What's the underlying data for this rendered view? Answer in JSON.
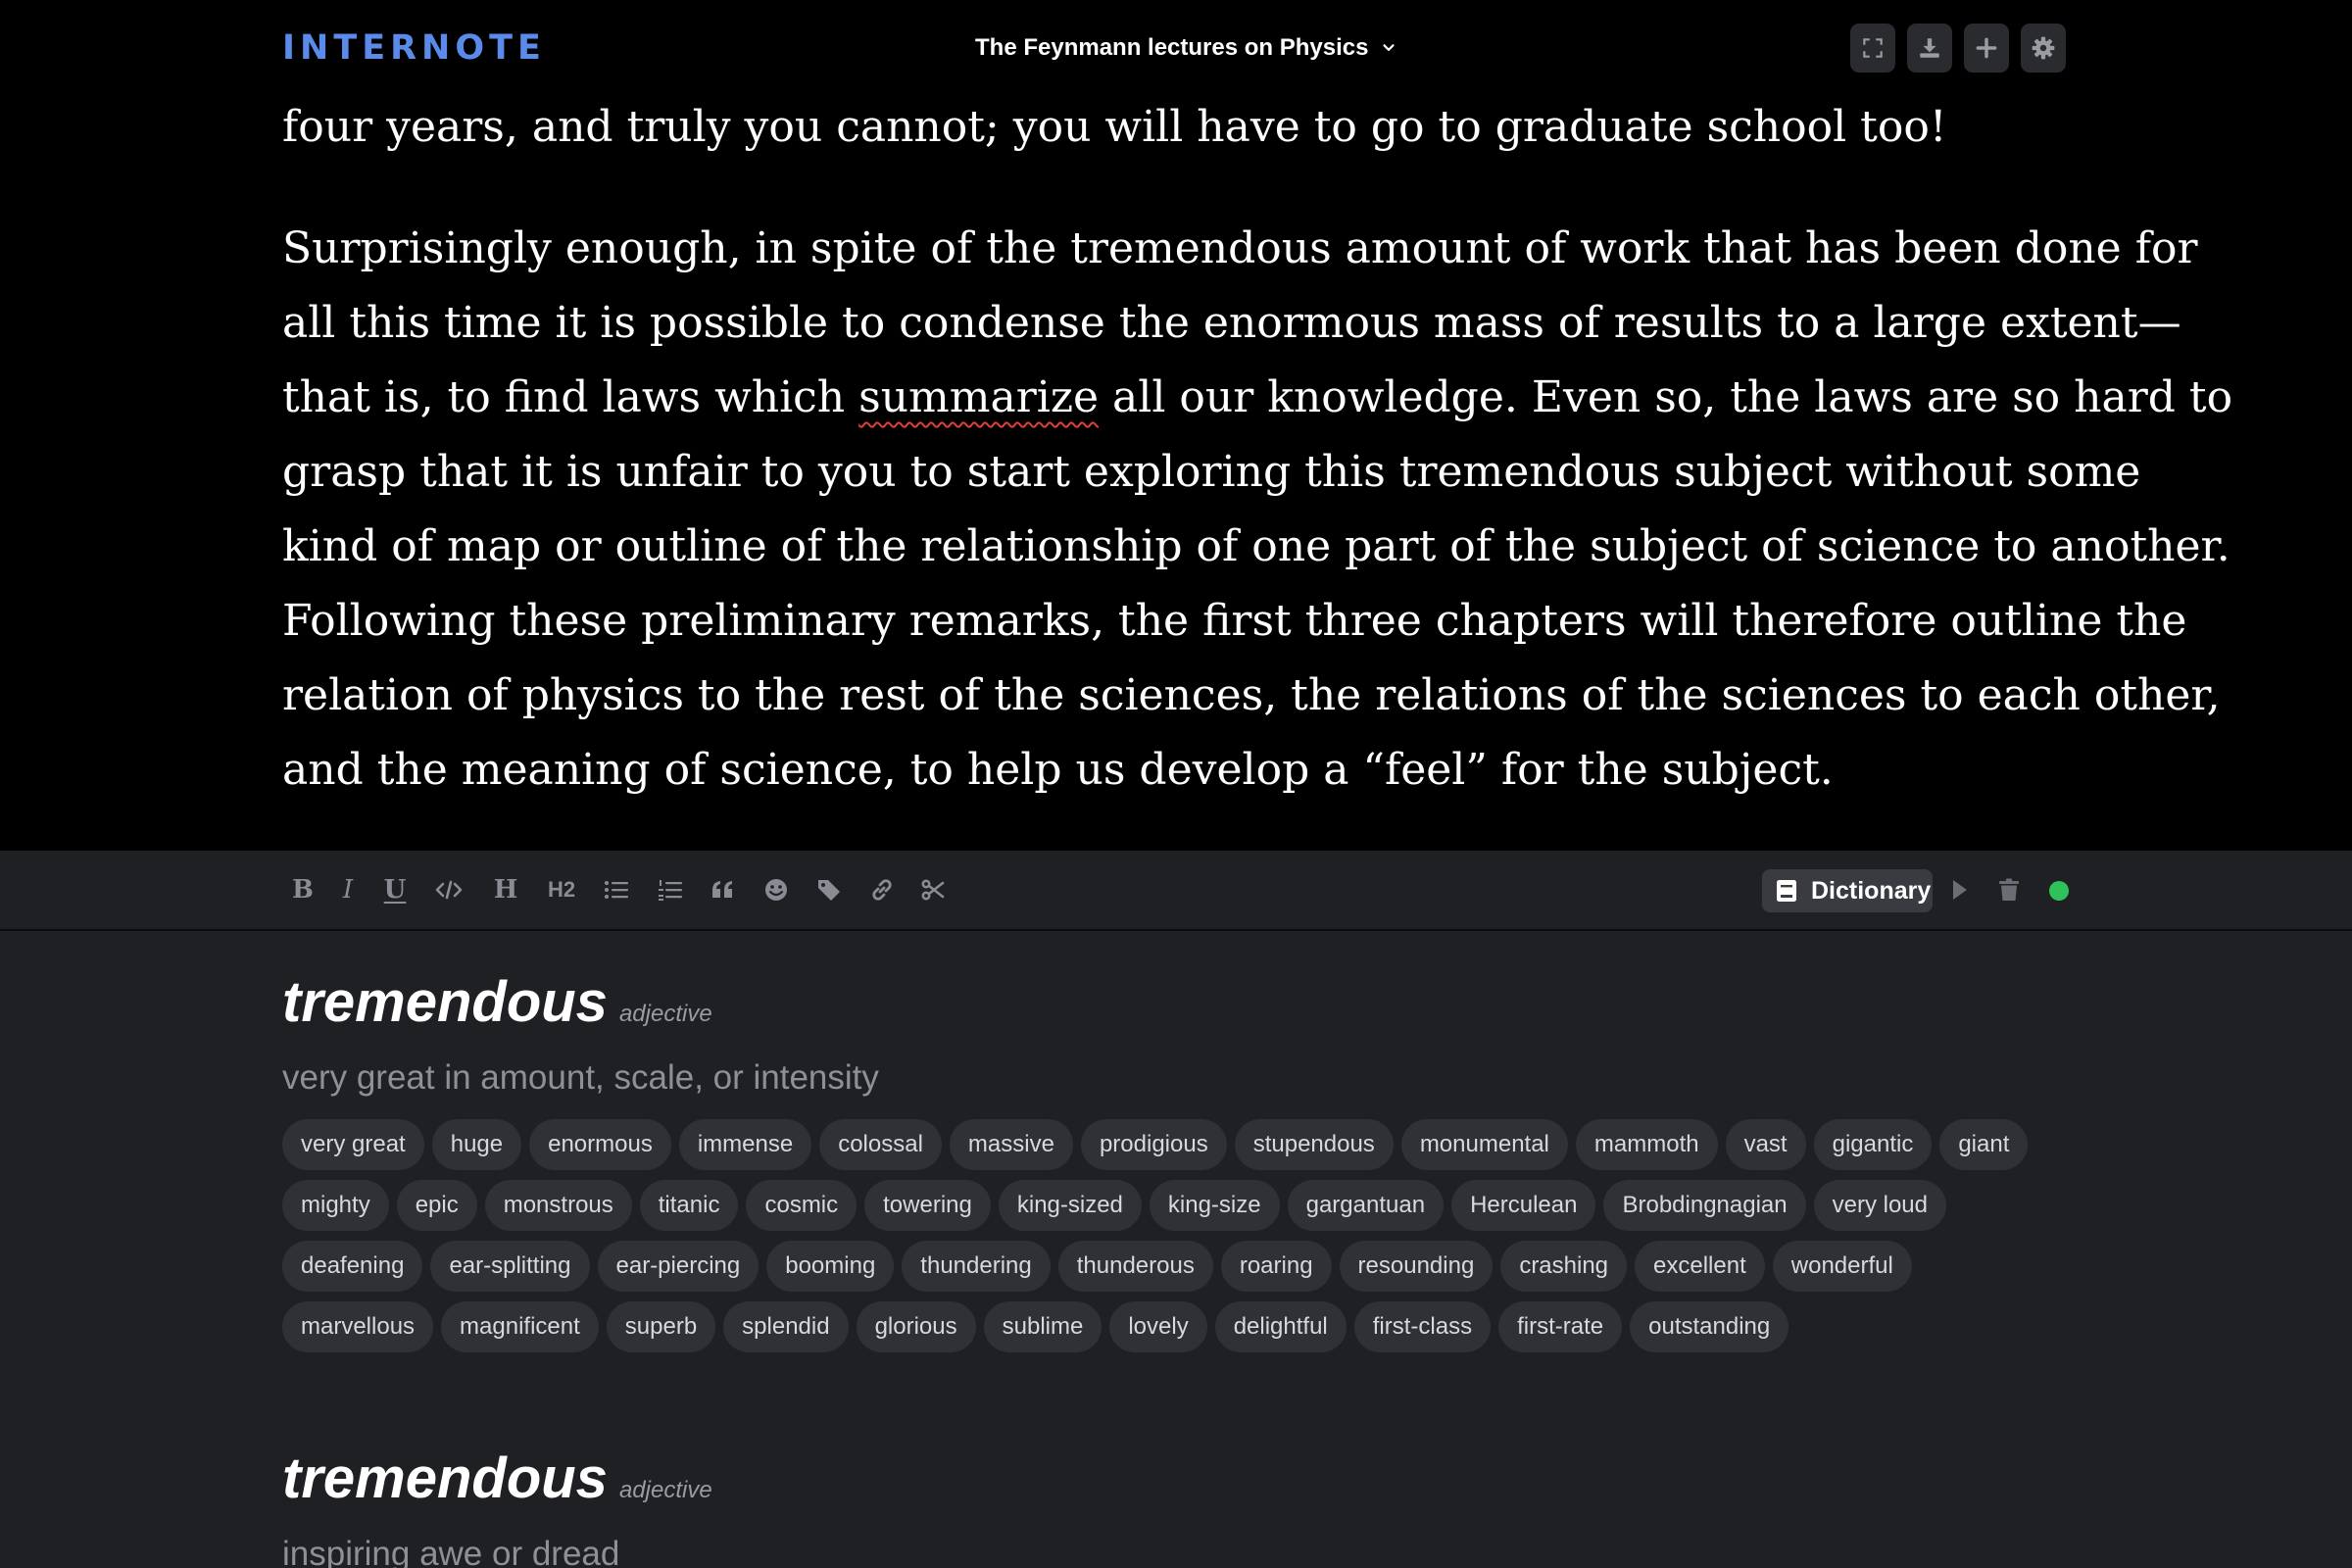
{
  "app": {
    "brand": "INTERNOTE",
    "document_title": "The Feynmann lectures on Physics",
    "accent_color": "#5b8bea"
  },
  "header_buttons": [
    {
      "name": "fullscreen-icon"
    },
    {
      "name": "download-icon"
    },
    {
      "name": "plus-icon"
    },
    {
      "name": "gear-icon"
    }
  ],
  "editor": {
    "para1_lines": [
      "four years, and truly you cannot; you will have to go to graduate school too!"
    ],
    "para2": {
      "line1": "Surprisingly enough, in spite of the tremendous amount of work that has been done for",
      "line2": "all this time it is possible to condense the enormous mass of results to a large extent—",
      "line3_before": "that is, to find laws which ",
      "line3_flagged": "summarize",
      "line3_after": " all our knowledge. Even so, the laws are so hard to",
      "line4": "grasp that it is unfair to you to start exploring this tremendous subject without some",
      "line5": "kind of map or outline of the relationship of one part of the subject of science to another.",
      "line6": "Following these preliminary remarks, the first three chapters will therefore outline the",
      "line7": "relation of physics to the rest of the sciences, the relations of the sciences to each other,",
      "line8": "and the meaning of science, to help us develop a “feel” for the subject."
    }
  },
  "toolbar": {
    "format_buttons": [
      {
        "name": "bold-icon",
        "glyph": "B"
      },
      {
        "name": "italic-icon",
        "glyph": "I"
      },
      {
        "name": "underline-icon",
        "glyph": "U"
      },
      {
        "name": "code-icon"
      },
      {
        "name": "heading-icon",
        "glyph": "H"
      },
      {
        "name": "heading2-icon",
        "glyph": "H2"
      },
      {
        "name": "bullet-list-icon"
      },
      {
        "name": "numbered-list-icon"
      },
      {
        "name": "quote-icon"
      },
      {
        "name": "emoji-icon"
      },
      {
        "name": "tag-icon"
      },
      {
        "name": "link-icon"
      },
      {
        "name": "scissors-icon"
      }
    ],
    "dictionary_label": "Dictionary",
    "status_color": "#2ec35a"
  },
  "dictionary": {
    "entries": [
      {
        "word": "tremendous",
        "pos": "adjective",
        "definition": "very great in amount, scale, or intensity",
        "synonyms": [
          "very great",
          "huge",
          "enormous",
          "immense",
          "colossal",
          "massive",
          "prodigious",
          "stupendous",
          "monumental",
          "mammoth",
          "vast",
          "gigantic",
          "giant",
          "mighty",
          "epic",
          "monstrous",
          "titanic",
          "cosmic",
          "towering",
          "king-sized",
          "king-size",
          "gargantuan",
          "Herculean",
          "Brobdingnagian",
          "very loud",
          "deafening",
          "ear-splitting",
          "ear-piercing",
          "booming",
          "thundering",
          "thunderous",
          "roaring",
          "resounding",
          "crashing",
          "excellent",
          "wonderful",
          "marvellous",
          "magnificent",
          "superb",
          "splendid",
          "glorious",
          "sublime",
          "lovely",
          "delightful",
          "first-class",
          "first-rate",
          "outstanding"
        ]
      },
      {
        "word": "tremendous",
        "pos": "adjective",
        "definition": "inspiring awe or dread",
        "synonyms": []
      }
    ]
  }
}
